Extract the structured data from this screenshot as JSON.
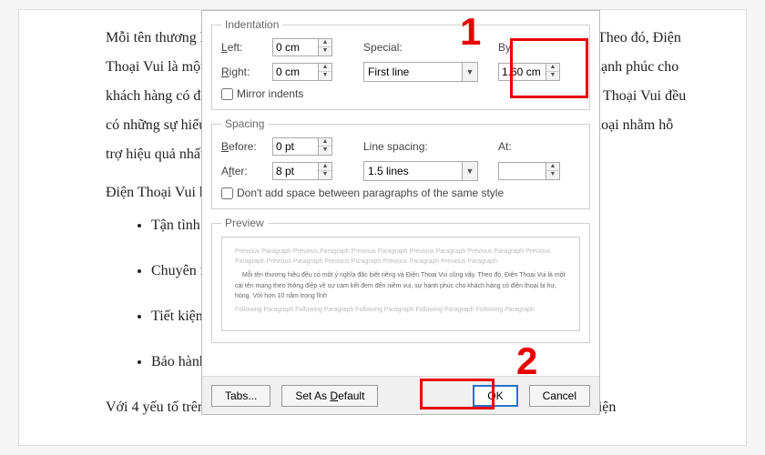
{
  "doc": {
    "p1": "Mỗi tên thương hiệu đều có một ý nghĩa đặc biệt riêng và Điện Thoại Vui cũng vậy. Theo đó, Điện Thoại Vui là một cái tên mang theo thông điệp về sự cam kết đem đến niềm vui, sự hạnh phúc cho khách hàng có điện thoại bị hư, hỏng. Với hơn 10 năm trong lĩnh vực bán lẻ thì Điện Thoại Vui đều có những sự hiểu biết về kiến thức hết sức chuyên sâu về các thiết bị hư hỏng điện thoại nhằm hỗ trợ hiệu quả nhất cho khách hàng khi có điện thoại gặp lỗi.",
    "p2": "Điện Thoại Vui hướng đến 4 yếu tố cơ bản:",
    "b1": "Tận tình",
    "b2": "Chuyên nghiệp",
    "b3": "Tiết kiệm",
    "b4": "Bảo hành",
    "p3": "Với 4 yếu tố trên, doanh nghiệp với mục tiêu tạo ra một hệ thống dịch vụ sửa chữa điện"
  },
  "dlg": {
    "indentation": {
      "title": "Indentation",
      "left_label": "Left:",
      "left_value": "0 cm",
      "right_label": "Right:",
      "right_value": "0 cm",
      "special_label": "Special:",
      "special_value": "First line",
      "by_label": "By:",
      "by_value": "1.60 cm",
      "mirror": "Mirror indents"
    },
    "spacing": {
      "title": "Spacing",
      "before_label": "Before:",
      "before_value": "0 pt",
      "after_label": "After:",
      "after_value": "8 pt",
      "linesp_label": "Line spacing:",
      "linesp_value": "1.5 lines",
      "at_label": "At:",
      "at_value": "",
      "noadd": "Don't add space between paragraphs of the same style"
    },
    "preview": {
      "title": "Preview",
      "ghost": "Previous Paragraph Previous Paragraph Previous Paragraph Previous Paragraph Previous Paragraph Previous Paragraph Previous Paragraph Previous Paragraph Previous Paragraph Previous Paragraph",
      "sample": "Mỗi tên thương hiệu đều có một ý nghĩa đặc biệt riêng và Điện Thoại Vui cũng vậy. Theo đó, Điện Thoại Vui là một cái tên mang theo thông điệp về sự cam kết đem đến niềm vui, sự hạnh phúc cho khách hàng có điện thoại bị hư, hỏng. Với hơn 10 năm trong lĩnh",
      "ghost2": "Following Paragraph Following Paragraph Following Paragraph Following Paragraph Following Paragraph"
    },
    "buttons": {
      "tabs": "Tabs...",
      "default": "Set As Default",
      "ok": "OK",
      "cancel": "Cancel"
    }
  },
  "callouts": {
    "one": "1",
    "two": "2"
  }
}
